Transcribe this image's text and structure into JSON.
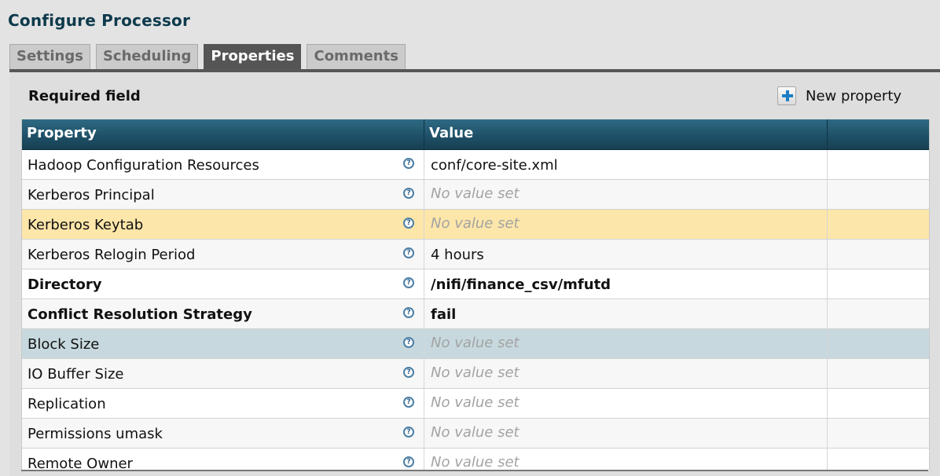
{
  "dialog": {
    "title": "Configure Processor"
  },
  "tabs": [
    {
      "label": "Settings",
      "active": false
    },
    {
      "label": "Scheduling",
      "active": false
    },
    {
      "label": "Properties",
      "active": true
    },
    {
      "label": "Comments",
      "active": false
    }
  ],
  "toolbar": {
    "required_label": "Required field",
    "new_property_label": "New property",
    "new_property_icon": "plus-icon"
  },
  "table": {
    "headers": {
      "property": "Property",
      "value": "Value",
      "actions": ""
    },
    "help_glyph": "?",
    "rows": [
      {
        "name": "Hadoop Configuration Resources",
        "value": "conf/core-site.xml",
        "required": false,
        "empty": false,
        "state": "odd"
      },
      {
        "name": "Kerberos Principal",
        "value": "No value set",
        "required": false,
        "empty": true,
        "state": "even"
      },
      {
        "name": "Kerberos Keytab",
        "value": "No value set",
        "required": false,
        "empty": true,
        "state": "highlight"
      },
      {
        "name": "Kerberos Relogin Period",
        "value": "4 hours",
        "required": false,
        "empty": false,
        "state": "even"
      },
      {
        "name": "Directory",
        "value": "/nifi/finance_csv/mfutd",
        "required": true,
        "empty": false,
        "state": "odd"
      },
      {
        "name": "Conflict Resolution Strategy",
        "value": "fail",
        "required": true,
        "empty": false,
        "state": "even"
      },
      {
        "name": "Block Size",
        "value": "No value set",
        "required": false,
        "empty": true,
        "state": "selected"
      },
      {
        "name": "IO Buffer Size",
        "value": "No value set",
        "required": false,
        "empty": true,
        "state": "even"
      },
      {
        "name": "Replication",
        "value": "No value set",
        "required": false,
        "empty": true,
        "state": "odd"
      },
      {
        "name": "Permissions umask",
        "value": "No value set",
        "required": false,
        "empty": true,
        "state": "even"
      },
      {
        "name": "Remote Owner",
        "value": "No value set",
        "required": false,
        "empty": true,
        "state": "odd"
      }
    ]
  },
  "colors": {
    "header_bg": "#1e5168",
    "highlight_row": "#fde6a9",
    "selected_row": "#c7d9de",
    "title": "#0e3a4c"
  }
}
